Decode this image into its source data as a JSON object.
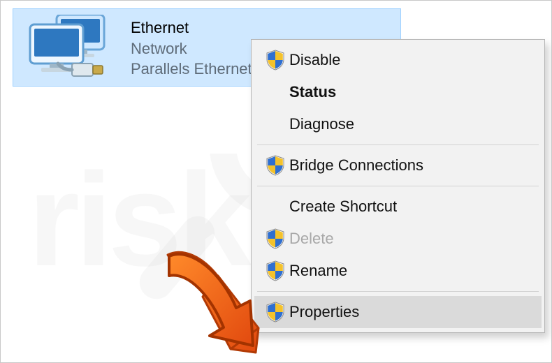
{
  "watermark_text": "risk.com",
  "adapter": {
    "title": "Ethernet",
    "line1": "Network",
    "line2": "Parallels Ethernet Adapter"
  },
  "menu": {
    "items": [
      {
        "label": "Disable",
        "shield": true,
        "bold": false,
        "disabled": false,
        "hover": false
      },
      {
        "label": "Status",
        "shield": false,
        "bold": true,
        "disabled": false,
        "hover": false
      },
      {
        "label": "Diagnose",
        "shield": false,
        "bold": false,
        "disabled": false,
        "hover": false
      },
      "sep",
      {
        "label": "Bridge Connections",
        "shield": true,
        "bold": false,
        "disabled": false,
        "hover": false
      },
      "sep",
      {
        "label": "Create Shortcut",
        "shield": false,
        "bold": false,
        "disabled": false,
        "hover": false
      },
      {
        "label": "Delete",
        "shield": true,
        "bold": false,
        "disabled": true,
        "hover": false
      },
      {
        "label": "Rename",
        "shield": true,
        "bold": false,
        "disabled": false,
        "hover": false
      },
      "sep",
      {
        "label": "Properties",
        "shield": true,
        "bold": false,
        "disabled": false,
        "hover": true
      }
    ]
  }
}
